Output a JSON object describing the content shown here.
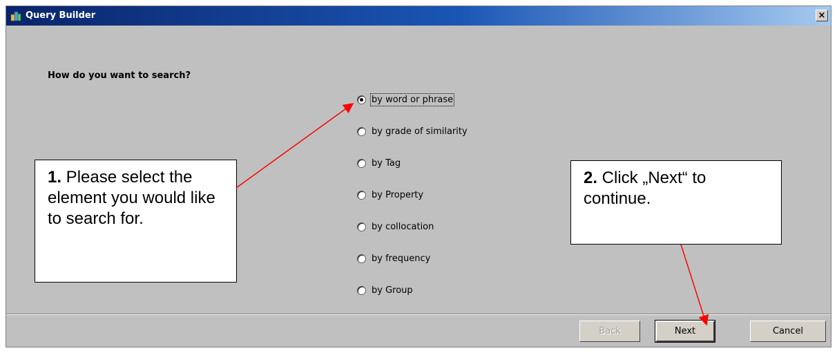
{
  "window": {
    "title": "Query Builder",
    "close_label": "×"
  },
  "main": {
    "question": "How do you want to search?",
    "options": [
      {
        "label": "by word or phrase",
        "selected": true
      },
      {
        "label": "by grade of similarity",
        "selected": false
      },
      {
        "label": "by Tag",
        "selected": false
      },
      {
        "label": "by Property",
        "selected": false
      },
      {
        "label": "by collocation",
        "selected": false
      },
      {
        "label": "by frequency",
        "selected": false
      },
      {
        "label": "by Group",
        "selected": false
      }
    ]
  },
  "buttons": {
    "back": "Back",
    "next": "Next",
    "cancel": "Cancel"
  },
  "callouts": {
    "step1_number": "1.",
    "step1_text": " Please select the element you would like to search for.",
    "step2_number": "2.",
    "step2_text": " Click „Next“ to continue."
  },
  "colors": {
    "titlebar_start": "#0a246a",
    "titlebar_end": "#a6caf0",
    "dialog_bg": "#c0c0c0",
    "arrow": "#ff0000"
  }
}
